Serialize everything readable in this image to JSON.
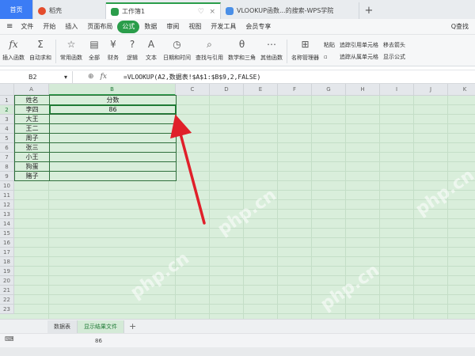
{
  "tabs": {
    "home": "首页",
    "docer": "稻壳",
    "workbook": "工作簿1",
    "web": "VLOOKUP函数...的搜索-WPS学院",
    "add": "+"
  },
  "menu": {
    "hamburger": "≡",
    "items": [
      "文件",
      "开始",
      "插入",
      "页面布局",
      "公式",
      "数据",
      "审阅",
      "视图",
      "开发工具",
      "会员专享"
    ],
    "active_index": 4,
    "search": "Q查找"
  },
  "ribbon": {
    "insert_function": "插入函数",
    "autosum": "自动求和",
    "common": "常用函数",
    "all": "全部",
    "finance": "财务",
    "logic": "逻辑",
    "text": "文本",
    "datetime": "日期和时间",
    "lookup": "查找与引用",
    "math": "数学和三角",
    "other": "其他函数",
    "name_manager": "名称管理器",
    "paste": "粘贴",
    "trace_precedents": "追踪引用单元格",
    "trace_dependents": "追踪从属单元格",
    "remove_arrows": "移去箭头",
    "show_formulas": "显示公式"
  },
  "formula_bar": {
    "cell_ref": "B2",
    "dropdown": "▾",
    "zoom_icon": "search-icon",
    "fx": "fx",
    "formula": "=VLOOKUP(A2,数据表!$A$1:$B$9,2,FALSE)"
  },
  "grid": {
    "columns": [
      "A",
      "B",
      "C",
      "D",
      "E",
      "F",
      "G",
      "H",
      "I",
      "J",
      "K"
    ],
    "selected_column": "B",
    "row_count": 23,
    "selected_row": 2,
    "headers": {
      "name": "姓名",
      "score": "分数"
    },
    "rows": [
      {
        "name": "李四",
        "score": "86"
      },
      {
        "name": "大王",
        "score": ""
      },
      {
        "name": "王二",
        "score": ""
      },
      {
        "name": "周子",
        "score": ""
      },
      {
        "name": "张三",
        "score": ""
      },
      {
        "name": "小王",
        "score": ""
      },
      {
        "name": "狗蛋",
        "score": ""
      },
      {
        "name": "赌子",
        "score": ""
      }
    ]
  },
  "sheets": {
    "tabs": [
      "数据表",
      "显示结果文件"
    ],
    "active_index": 1,
    "add": "+"
  },
  "status": {
    "sum": "86"
  },
  "watermark": "php.cn",
  "colors": {
    "accent": "#2a9d4a",
    "grid_bg": "#d9eedb",
    "arrow": "#e0202a",
    "home_tab": "#3b7cf5"
  }
}
